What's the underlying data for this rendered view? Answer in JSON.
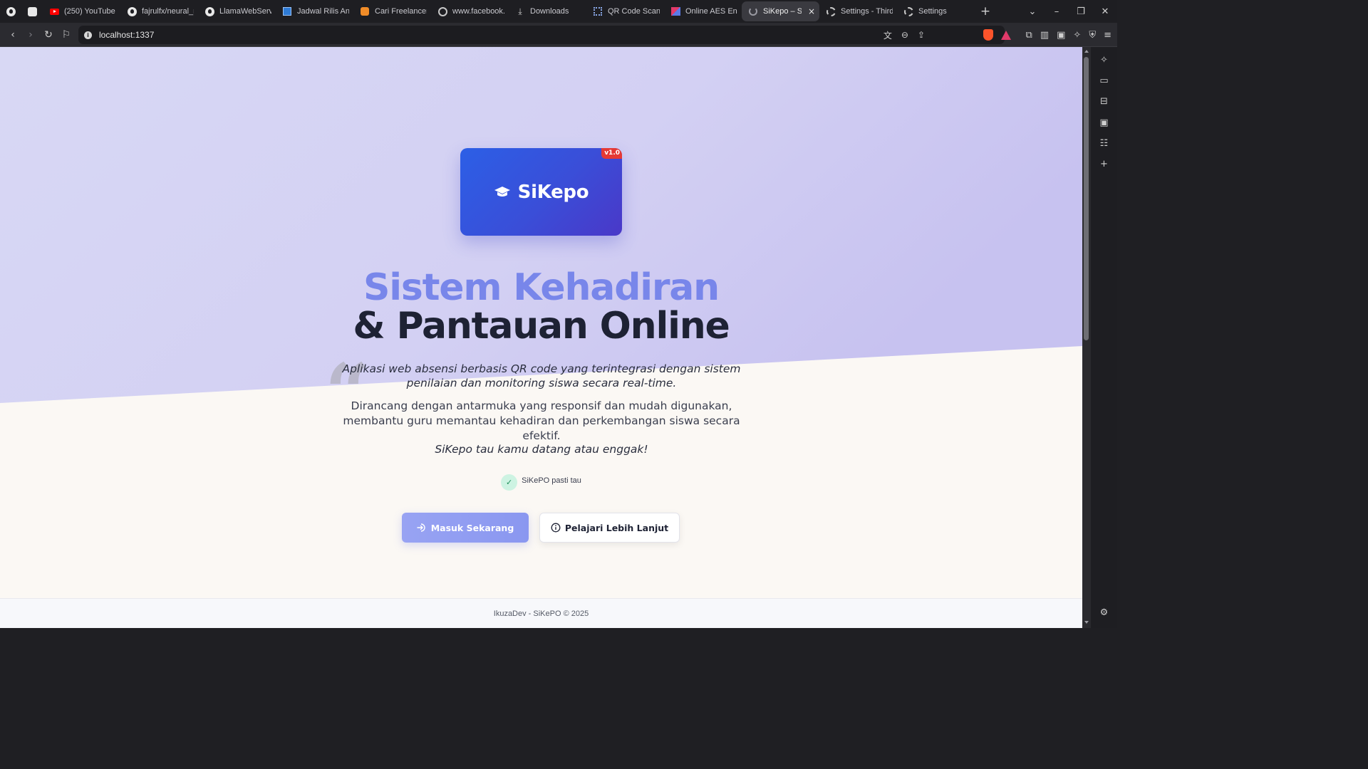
{
  "browser": {
    "tabs": [
      {
        "label": "(250) YouTube",
        "icon": "youtube-icon"
      },
      {
        "label": "fajrulfx/neural_r",
        "icon": "github-icon"
      },
      {
        "label": "LlamaWebServe",
        "icon": "github-icon"
      },
      {
        "label": "Jadwal Rilis Anir",
        "icon": "calendar-site-icon"
      },
      {
        "label": "Cari Freelancer I",
        "icon": "freelancer-site-icon"
      },
      {
        "label": "www.facebook.c",
        "icon": "facebook-icon"
      },
      {
        "label": "Downloads",
        "icon": "download-icon"
      },
      {
        "label": "QR Code Scann",
        "icon": "qr-code-icon"
      },
      {
        "label": "Online AES Enc",
        "icon": "aes-site-icon"
      },
      {
        "label": "SiKepo – Si",
        "icon": "loading-icon",
        "active": true
      },
      {
        "label": "Settings - Third",
        "icon": "gear-icon"
      },
      {
        "label": "Settings",
        "icon": "gear-icon"
      }
    ],
    "close_glyph": "×",
    "new_tab_glyph": "+",
    "url": "localhost:1337"
  },
  "page": {
    "logo_text": "SiKepo",
    "logo_badge": "v1.0",
    "title_line1": "Sistem Kehadiran",
    "title_line2": "& Pantauan Online",
    "quote_glyph": "“",
    "lead": "Aplikasi web absensi berbasis QR code yang terintegrasi dengan sistem penilaian dan monitoring siswa secara real-time.",
    "body": "Dirancang dengan antarmuka yang responsif dan mudah digunakan, membantu guru memantau kehadiran dan perkembangan siswa secara efektif.",
    "tagline": "SiKepo tau kamu datang atau enggak!",
    "check_label": "SiKePO pasti tau",
    "primary_button": "Masuk Sekarang",
    "secondary_button": "Pelajari Lebih Lanjut",
    "footer": "IkuzaDev - SiKePO © 2025"
  },
  "colors": {
    "hero_top": "#d8d8f4",
    "hero_accent": "#c7c2f0",
    "page_bg": "#fbf8f4",
    "title_accent": "#7886ea",
    "title_dark": "#1e2234",
    "logo_gradient": [
      "#2c5fe6",
      "#4a38c8"
    ],
    "badge": "#e53935",
    "primary_button": "#8f9bf1"
  }
}
